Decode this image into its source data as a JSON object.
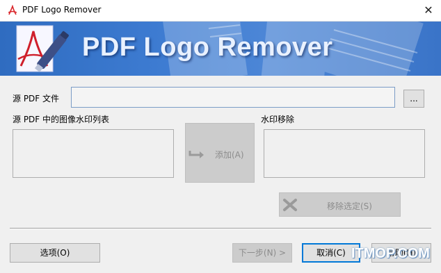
{
  "window": {
    "title": "PDF Logo Remover",
    "close_glyph": "✕"
  },
  "banner": {
    "title": "PDF Logo Remover"
  },
  "source": {
    "label": "源 PDF 文件",
    "value": "",
    "browse_label": "..."
  },
  "image_list": {
    "label": "源 PDF 中的图像水印列表"
  },
  "add_button": {
    "label": "添加(A)"
  },
  "removal_list": {
    "label": "水印移除"
  },
  "remove_selected_button": {
    "label": "移除选定(S)"
  },
  "footer": {
    "options_label": "选项(O)",
    "next_label": "下一步(N) >",
    "cancel_label": "取消(C)",
    "help_label": "帮助(H)"
  },
  "watermark_text": "ITMOP.COM",
  "colors": {
    "banner": "#3d7bd1",
    "accent": "#0078d7"
  }
}
